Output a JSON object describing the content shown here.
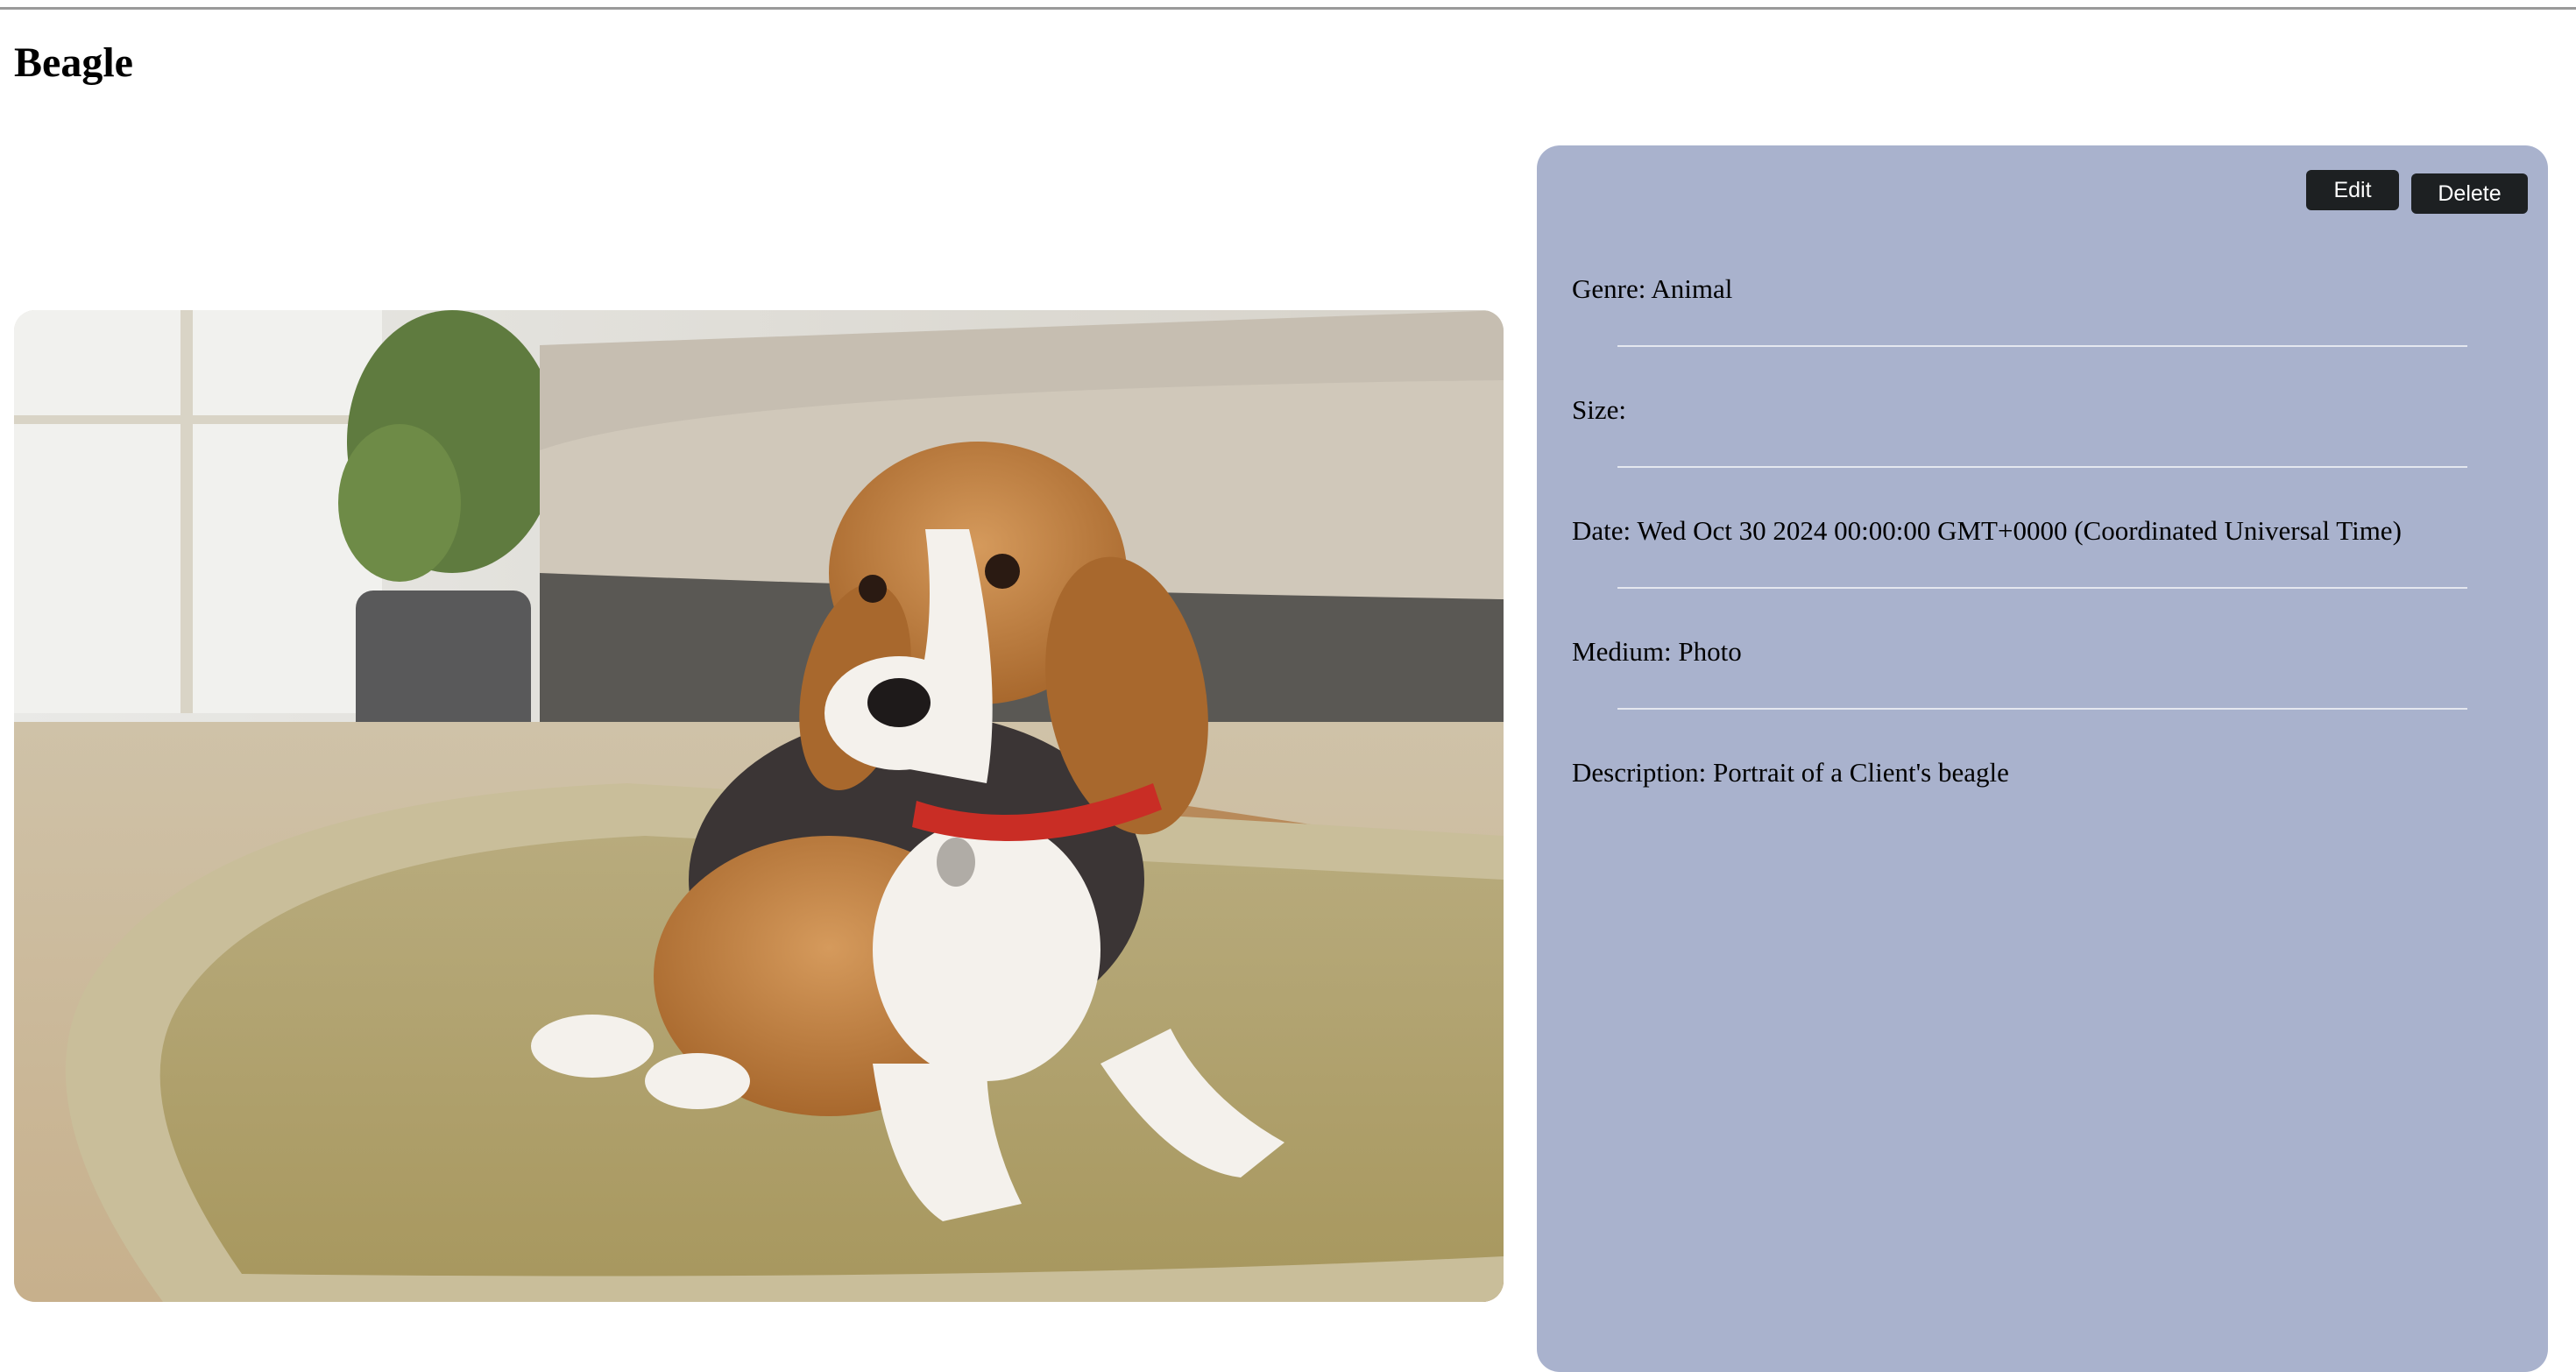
{
  "page": {
    "title": "Beagle"
  },
  "photo": {
    "alt": "Beagle"
  },
  "actions": {
    "edit_label": "Edit",
    "delete_label": "Delete"
  },
  "details": {
    "genre": "Genre: Animal",
    "size": "Size:",
    "date": "Date: Wed Oct 30 2024 00:00:00 GMT+0000 (Coordinated Universal Time)",
    "medium": "Medium: Photo",
    "description": "Description: Portrait of a Client's beagle"
  },
  "colors": {
    "panel_background": "#a9b2cd",
    "button_background": "#1d2022",
    "button_text": "#ffffff",
    "divider": "#e4e7ef"
  }
}
